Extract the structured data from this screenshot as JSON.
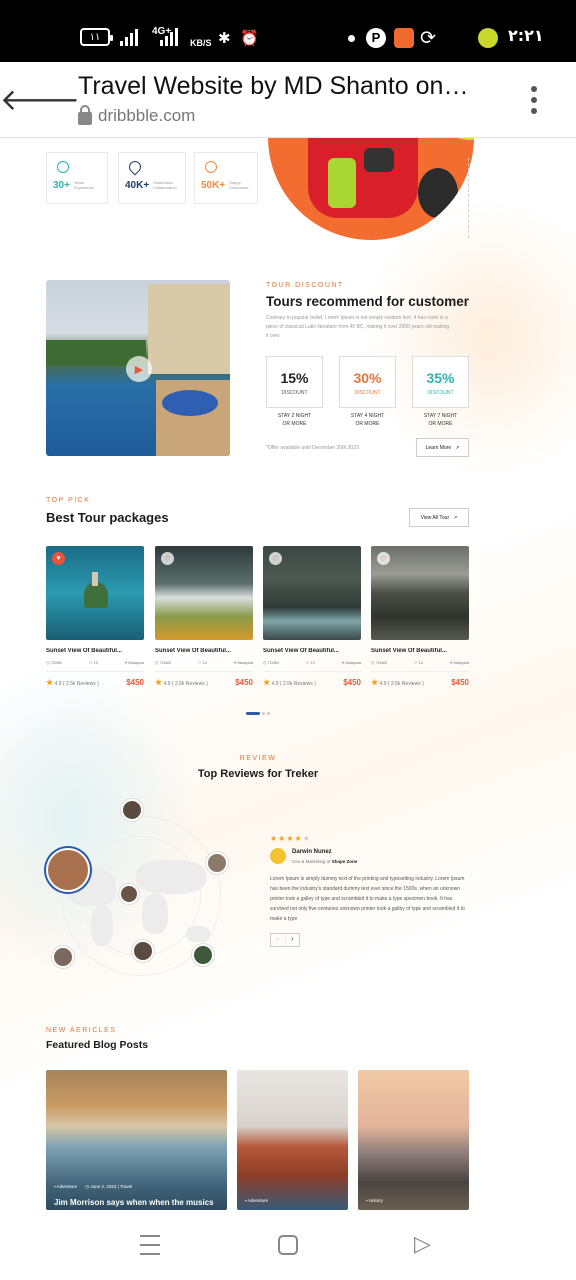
{
  "status_bar": {
    "battery": "١١",
    "network": "4G+",
    "speed": "KB/S",
    "time": "٢:٢١"
  },
  "browser": {
    "title": "Travel Website by MD Shanto on…",
    "url": "dribbble.com"
  },
  "stats": [
    {
      "value": "30+",
      "label": "Years Experience",
      "color": "#2bb5a8"
    },
    {
      "value": "40K+",
      "label": "Destination Collaboration",
      "color": "#1d3f6e"
    },
    {
      "value": "50K+",
      "label": "Happy Customers",
      "color": "#f08a3e"
    }
  ],
  "discount": {
    "kicker": "TOUR DISCOUNT",
    "title": "Tours recommend for customer",
    "body": "Contrary to popular belief, Lorem Ipsum is not simply random text. It has roots in a piece of classical Latin literature from 45 BC, making it over 2000 years old making it over",
    "cards": [
      {
        "value": "15%",
        "label": "DISCOUNT",
        "sub1": "STAY 2 NIGHT",
        "sub2": "OR MORE",
        "color": "#222222"
      },
      {
        "value": "30%",
        "label": "DISCOUNT",
        "sub1": "STAY 4 NIGHT",
        "sub2": "OR MORE",
        "color": "#e8743a"
      },
      {
        "value": "35%",
        "label": "DISCOUNT",
        "sub1": "STAY 7 NIGHT",
        "sub2": "OR MORE",
        "color": "#2bb5b0"
      }
    ],
    "offer": "*Offer available until December 30th,2023",
    "learn_more": "Learn More"
  },
  "packages": {
    "kicker": "TOP PICK",
    "title": "Best Tour packages",
    "view_all": "View All Tour",
    "cards": [
      {
        "title": "Sunset View Of Beautiful...",
        "days": "7D/6N",
        "people": "12",
        "place": "Malaysia",
        "rating": "4.9",
        "reviews": "( 2.5k Reviews )",
        "price": "$450"
      },
      {
        "title": "Sunset View Of Beautiful...",
        "days": "7D/6N",
        "people": "12",
        "place": "Malaysia",
        "rating": "4.9",
        "reviews": "( 2.5k Reviews )",
        "price": "$450"
      },
      {
        "title": "Sunset View Of Beautiful...",
        "days": "7D/6N",
        "people": "12",
        "place": "Malaysia",
        "rating": "4.9",
        "reviews": "( 2.5k Reviews )",
        "price": "$450"
      },
      {
        "title": "Sunset View Of Beautiful...",
        "days": "7D/6N",
        "people": "12",
        "place": "Malaysia",
        "rating": "4.9",
        "reviews": "( 2.5k Reviews )",
        "price": "$450"
      }
    ]
  },
  "review": {
    "kicker": "REVIEW",
    "title": "Top Reviews for Treker",
    "name": "Darwin Nunez",
    "role_prefix": "Ceo & Marketing of",
    "company": "Shape Zone",
    "body": "Lorem Ipsum is simply dummy text of the printing and typesetting industry. Lorem Ipsum has been the industry's standard dummy text ever since the 1500s, when an unknown printer took a galley of type and scrambled it to make a type specimen book. It has survived not only five centuries unknown printer took a galley of type and scrambled it to make a type"
  },
  "blog": {
    "kicker": "NEW AERICLES",
    "title": "Featured Blog Posts",
    "post1_cat": "Adventure",
    "post1_date": "June 2, 2023",
    "post1_tag": "Travel",
    "post1_title": "Jim Morrison says when when the musics",
    "post2_cat": "Adventure",
    "post3_cat": "History"
  }
}
